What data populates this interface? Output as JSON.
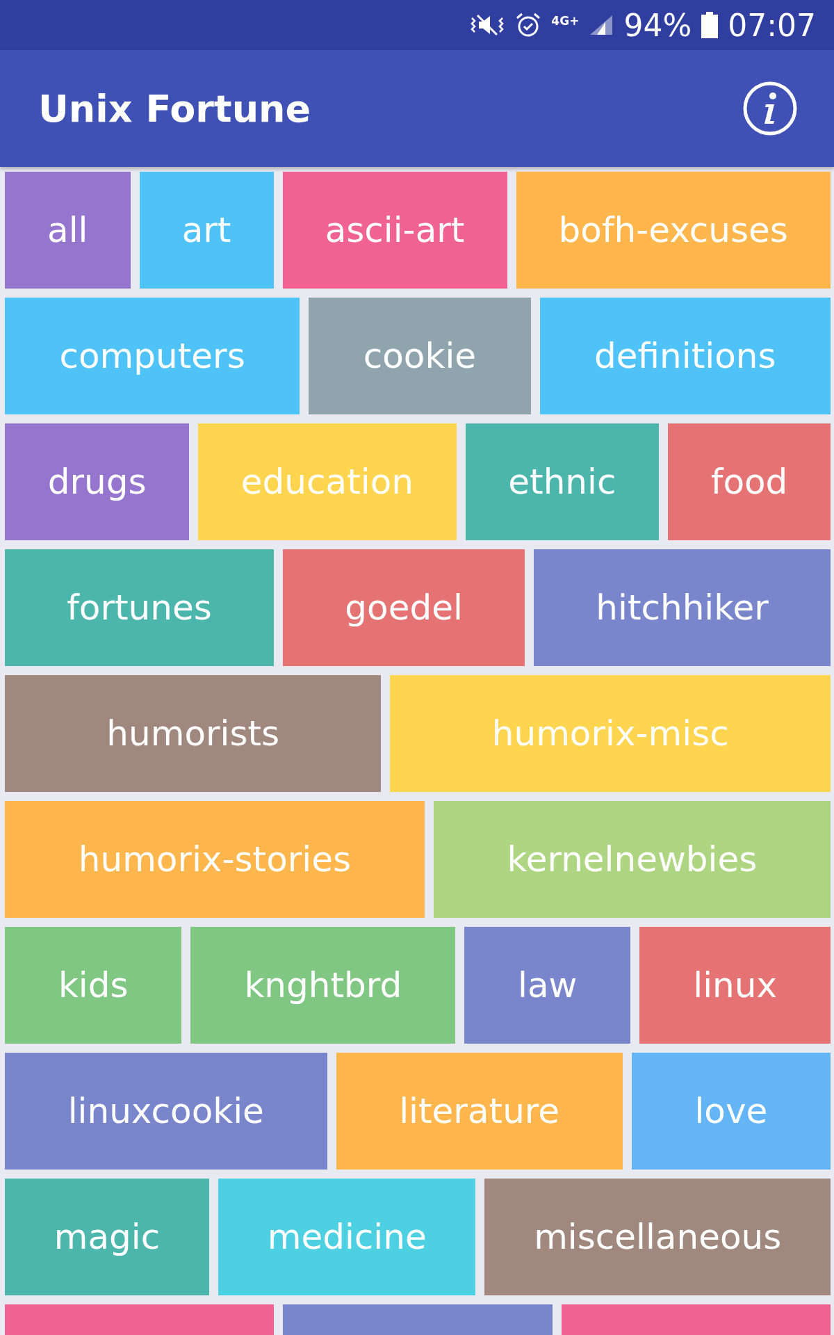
{
  "status_bar": {
    "network": "4G+",
    "battery": "94%",
    "time": "07:07"
  },
  "app_bar": {
    "title": "Unix Fortune"
  },
  "rows": [
    [
      {
        "label": "all",
        "color": "#9575cd"
      },
      {
        "label": "art",
        "color": "#4fc3f7"
      },
      {
        "label": "ascii-art",
        "color": "#f06292"
      },
      {
        "label": "bofh-excuses",
        "color": "#ffb74d"
      }
    ],
    [
      {
        "label": "computers",
        "color": "#4fc3f7"
      },
      {
        "label": "cookie",
        "color": "#90a4ae"
      },
      {
        "label": "definitions",
        "color": "#4fc3f7"
      }
    ],
    [
      {
        "label": "drugs",
        "color": "#9575cd"
      },
      {
        "label": "education",
        "color": "#ffd54f"
      },
      {
        "label": "ethnic",
        "color": "#4db6ac"
      },
      {
        "label": "food",
        "color": "#e57373"
      }
    ],
    [
      {
        "label": "fortunes",
        "color": "#4db6ac"
      },
      {
        "label": "goedel",
        "color": "#e57373"
      },
      {
        "label": "hitchhiker",
        "color": "#7986cb"
      }
    ],
    [
      {
        "label": "humorists",
        "color": "#a1887f"
      },
      {
        "label": "humorix-misc",
        "color": "#ffd54f"
      }
    ],
    [
      {
        "label": "humorix-stories",
        "color": "#ffb74d"
      },
      {
        "label": "kernelnewbies",
        "color": "#aed581"
      }
    ],
    [
      {
        "label": "kids",
        "color": "#81c784"
      },
      {
        "label": "knghtbrd",
        "color": "#81c784"
      },
      {
        "label": "law",
        "color": "#7986cb"
      },
      {
        "label": "linux",
        "color": "#e57373"
      }
    ],
    [
      {
        "label": "linuxcookie",
        "color": "#7986cb"
      },
      {
        "label": "literature",
        "color": "#ffb74d"
      },
      {
        "label": "love",
        "color": "#64b5f6"
      }
    ],
    [
      {
        "label": "magic",
        "color": "#4db6ac"
      },
      {
        "label": "medicine",
        "color": "#4dd0e1"
      },
      {
        "label": "miscellaneous",
        "color": "#a1887f"
      }
    ],
    [
      {
        "color": "#f06292"
      },
      {
        "color": "#7986cb"
      },
      {
        "color": "#f06292"
      }
    ]
  ]
}
